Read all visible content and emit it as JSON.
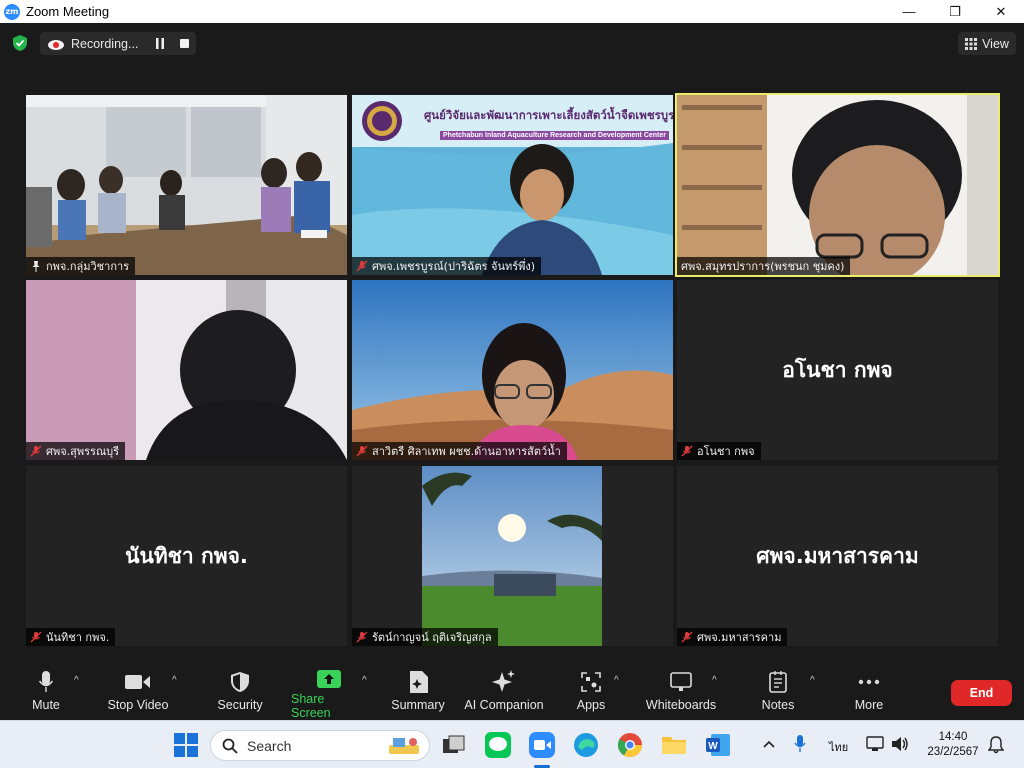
{
  "window": {
    "title": "Zoom Meeting",
    "logo_text": "zm",
    "controls": {
      "minimize": "—",
      "maximize": "❐",
      "close": "✕"
    }
  },
  "topbar": {
    "recording_label": "Recording...",
    "view_label": "View"
  },
  "tiles": [
    {
      "name": "กพจ.กลุ่มวิชาการ",
      "type": "video",
      "pinned": true
    },
    {
      "name": "ศพจ.เพชรบูรณ์(ปาริฉัตร จันทร์พึ่ง)",
      "type": "video",
      "muted": true,
      "banner_th": "ศูนย์วิจัยและพัฒนาการเพาะเลี้ยงสัตว์น้ำจืดเพชรบูรณ์",
      "banner_en": "Phetchabun Inland Aquaculture Research and Development Center"
    },
    {
      "name": "ศพจ.สมุทรปราการ(พรชนก ชุมคง)",
      "type": "video",
      "active_speaker": true
    },
    {
      "name": "ศพจ.สุพรรณบุรี",
      "type": "video",
      "muted": true
    },
    {
      "name": "สาวิตรี ศิลาเทพ ผชช.ด้านอาหารสัตว์น้ำ",
      "type": "video",
      "muted": true
    },
    {
      "name": "อโนชา กพจ",
      "type": "avatar",
      "display": "อโนชา กพจ",
      "muted": true
    },
    {
      "name": "นันทิชา กพจ.",
      "type": "avatar",
      "display": "นันทิชา กพจ.",
      "muted": true
    },
    {
      "name": "รัตน์กาญจน์ ฤติเจริญสกุล",
      "type": "video",
      "muted": true
    },
    {
      "name": "ศพจ.มหาสารคาม",
      "type": "avatar",
      "display": "ศพจ.มหาสารคาม",
      "muted": true
    }
  ],
  "toolbar": {
    "mute": "Mute",
    "stop_video": "Stop Video",
    "security": "Security",
    "share_screen": "Share Screen",
    "summary": "Summary",
    "ai_companion": "AI Companion",
    "apps": "Apps",
    "whiteboards": "Whiteboards",
    "notes": "Notes",
    "more": "More",
    "end": "End",
    "accent_green": "#3ad35a",
    "end_red": "#e02828"
  },
  "taskbar": {
    "search_placeholder": "Search",
    "input_language": "ไทย",
    "time": "14:40",
    "date": "23/2/2567"
  }
}
